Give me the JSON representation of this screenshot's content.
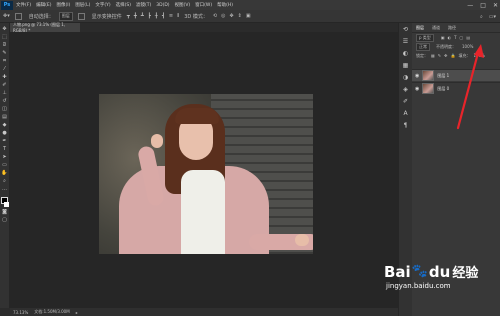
{
  "app": {
    "logo": "Ps"
  },
  "menubar": {
    "items": [
      "文件(F)",
      "编辑(E)",
      "图像(I)",
      "图层(L)",
      "文字(Y)",
      "选择(S)",
      "滤镜(T)",
      "3D(D)",
      "视图(V)",
      "窗口(W)",
      "帮助(H)"
    ],
    "minimize": "—",
    "maximize": "□",
    "close": "✕"
  },
  "options": {
    "auto_select_label": "自动选择：",
    "auto_select_value": "图层",
    "show_transform_label": "显示变换控件",
    "mode_label": "3D 模式："
  },
  "document": {
    "tab_title": "人物.png @ 73.1% (图层 1, RGB/8) *"
  },
  "status": {
    "zoom": "73.13%",
    "doc_info": "文档:1.50M/3.00M"
  },
  "panel": {
    "tabs": [
      "图层",
      "通道",
      "路径"
    ],
    "kind_label": "p 类型",
    "blend_mode": "正常",
    "opacity_label": "不透明度：",
    "opacity_value": "100%",
    "lock_label": "锁定：",
    "fill_label": "填充：",
    "fill_value": "100%",
    "layers": [
      {
        "name": "图层 1",
        "selected": true
      },
      {
        "name": "图层 0",
        "selected": false
      }
    ]
  },
  "annotation": {
    "arrow_color": "#e8242a"
  },
  "watermark": {
    "brand": "Bai",
    "brand2": "du",
    "cn": "经验",
    "url": "jingyan.baidu.com"
  }
}
